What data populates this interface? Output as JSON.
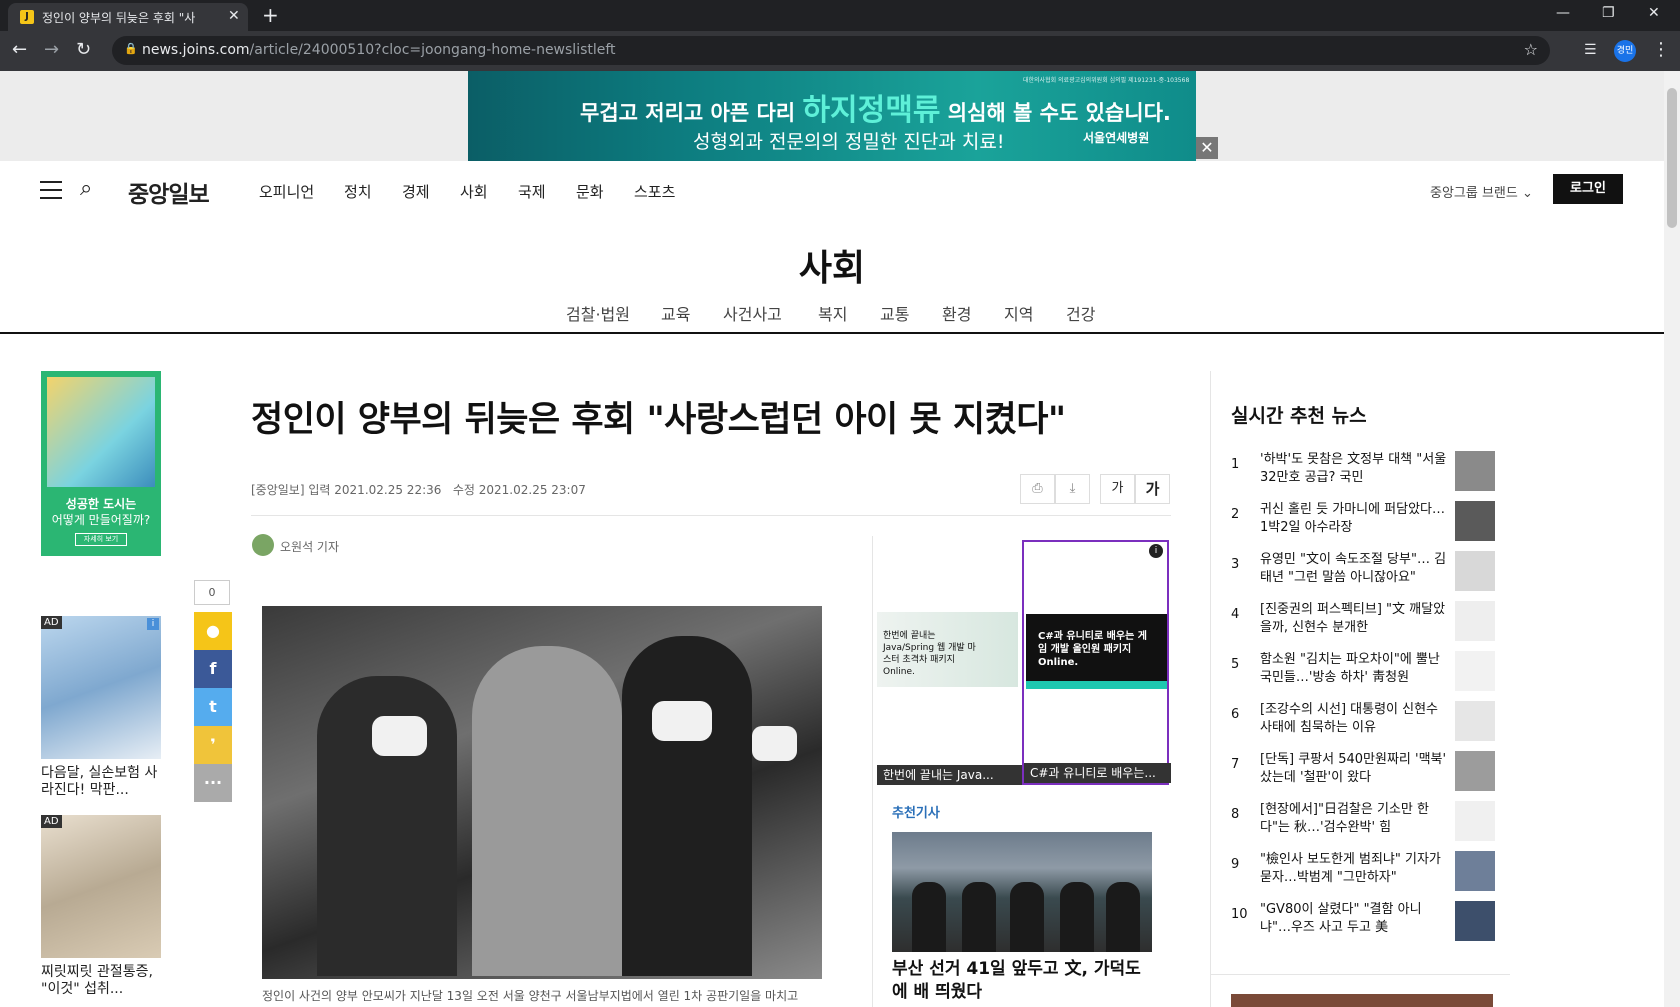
{
  "browser": {
    "tab_title": "정인이 양부의 뒤늦은 후회 \"사",
    "url_host": "news.joins.com",
    "url_path": "/article/24000510?cloc=joongang-home-newslistleft",
    "profile_label": "경민"
  },
  "top_ad": {
    "line1_a": "무겁고 저리고 아픈 다리 ",
    "line1_highlight": "하지정맥류",
    "line1_b": " 의심해 볼 수도 있습니다.",
    "line2": "성형외과 전문의의 정밀한 진단과 치료!",
    "brand": "서울연세병원",
    "note": "대한의사협회 의료광고심의위원회 심의필 제191231-중-103568"
  },
  "header": {
    "logo": "중앙일보",
    "nav": [
      "오피니언",
      "정치",
      "경제",
      "사회",
      "국제",
      "문화",
      "스포츠"
    ],
    "brand_menu": "중앙그룹 브랜드",
    "login": "로그인"
  },
  "section": {
    "title": "사회",
    "subnav": [
      "검찰·법원",
      "교육",
      "사건사고",
      "복지",
      "교통",
      "환경",
      "지역",
      "건강"
    ]
  },
  "left_ads": {
    "city_line1": "성공한 도시는",
    "city_line2": "어떻게 만들어질까?",
    "city_btn": "자세히 보기",
    "ad_badge": "AD",
    "card1_caption": "다음달, 실손보험 사라진다! 막판...",
    "card2_caption": "찌릿찌릿 관절통증, \"이것\" 섭취..."
  },
  "share": {
    "count": "0"
  },
  "article": {
    "headline": "정인이 양부의 뒤늦은 후회 \"사랑스럽던 아이 못 지켰다\"",
    "source": "[중앙일보]",
    "published_label": "입력",
    "published": "2021.02.25 22:36",
    "modified_label": "수정",
    "modified": "2021.02.25 23:07",
    "font_small": "가",
    "font_large": "가",
    "reporter": "오원석 기자",
    "caption": "정인이 사건의 양부 안모씨가 지난달 13일 오전 서울 양천구 서울남부지법에서 열린 1차 공판기일을 마치고"
  },
  "content_ads": {
    "ad1_banner": "한번에 끝내는 Java/Spring 웹 개발 마스터 초격차 패키지 Online.",
    "ad1_caption": "한번에 끝내는 Java...",
    "ad2_banner": "C#과 유니티로 배우는 게임 개발 올인원 패키지 Online.",
    "ad2_caption": "C#과 유니티로 배우는..."
  },
  "recommend": {
    "label": "추천기사",
    "title": "부산 선거 41일 앞두고 文, 가덕도에 배 띄웠다"
  },
  "realtime": {
    "title": "실시간 추천 뉴스",
    "items": [
      {
        "rank": "1",
        "title": "'하박'도 못참은 文정부 대책 \"서울 32만호 공급? 국민"
      },
      {
        "rank": "2",
        "title": "귀신 홀린 듯 가마니에 퍼담았다…1박2일 아수라장"
      },
      {
        "rank": "3",
        "title": "유영민 \"文이 속도조절 당부\"… 김태년 \"그런 말씀 아니잖아요\""
      },
      {
        "rank": "4",
        "title": "[진중권의 퍼스펙티브] \"文 깨달았을까, 신현수 분개한"
      },
      {
        "rank": "5",
        "title": "함소원 \"김치는 파오차이\"에 뿔난 국민들…'방송 하차' 靑청원"
      },
      {
        "rank": "6",
        "title": "[조강수의 시선] 대통령이 신현수 사태에 침묵하는 이유"
      },
      {
        "rank": "7",
        "title": "[단독] 쿠팡서 540만원짜리 '맥북' 샀는데 '철판'이 왔다"
      },
      {
        "rank": "8",
        "title": "[현장에서]\"日검찰은 기소만 한다\"는 秋…'검수완박' 힘"
      },
      {
        "rank": "9",
        "title": "\"檢인사 보도한게 범죄냐\" 기자가 묻자…박범계 \"그만하자\""
      },
      {
        "rank": "10",
        "title": "\"GV80이 살렸다\" \"결함 아니냐\"…우즈 사고 두고 美"
      }
    ]
  },
  "colors": {
    "ad_teal": "#0d7d80",
    "ad_highlight": "#5ef0d8",
    "city_ad_green": "#2bb673",
    "share_yellow": "#f5c518",
    "facebook": "#3b5998",
    "twitter": "#55acee",
    "selected_ad_border": "#7b2fbe",
    "recommend_blue": "#2a6fb8"
  }
}
